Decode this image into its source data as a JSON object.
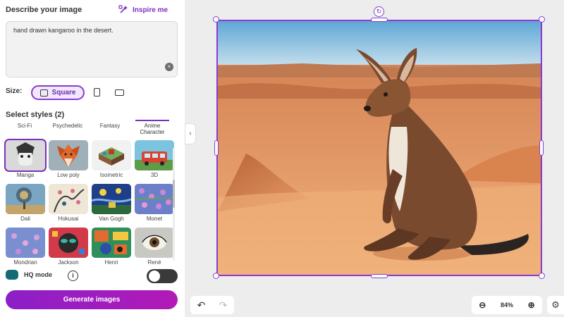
{
  "prompt_section": {
    "title": "Describe your image",
    "inspire_label": "Inspire me",
    "prompt_text": "hand drawn kangaroo in the desert."
  },
  "size": {
    "label": "Size:",
    "selected": "Square"
  },
  "styles": {
    "heading": "Select styles (2)",
    "tabs": [
      "Sci-Fi",
      "Psychedelic",
      "Fantasy",
      "Anime Character"
    ],
    "active_tab": "Anime Character",
    "items": [
      {
        "label": "Manga",
        "selected": true
      },
      {
        "label": "Low poly",
        "selected": false
      },
      {
        "label": "Isometric",
        "selected": false
      },
      {
        "label": "3D",
        "selected": false
      },
      {
        "label": "Dali",
        "selected": false
      },
      {
        "label": "Hokusai",
        "selected": false
      },
      {
        "label": "Van Gogh",
        "selected": false
      },
      {
        "label": "Monet",
        "selected": false
      },
      {
        "label": "Mondrian",
        "selected": false
      },
      {
        "label": "Jackson",
        "selected": false
      },
      {
        "label": "Henri",
        "selected": false
      },
      {
        "label": "René",
        "selected": false
      }
    ]
  },
  "hq_mode": {
    "label": "HQ mode",
    "enabled": false
  },
  "generate_label": "Generate images",
  "zoom": {
    "level": "84%"
  },
  "colors": {
    "accent": "#8a3ccf",
    "generate_start": "#8b1fc8",
    "generate_end": "#b21ab6",
    "canvas_bg": "#ededee"
  }
}
